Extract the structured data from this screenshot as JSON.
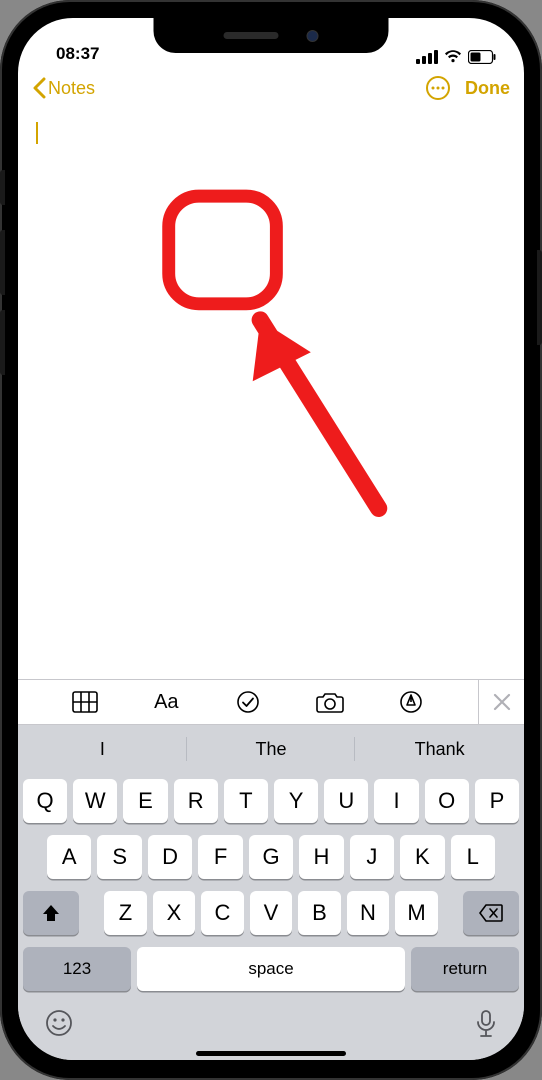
{
  "status": {
    "time": "08:37"
  },
  "nav": {
    "back_label": "Notes",
    "done_label": "Done"
  },
  "toolbar": {
    "icons": [
      "table-icon",
      "text-format-icon",
      "checklist-icon",
      "camera-icon",
      "markup-icon"
    ]
  },
  "suggestions": [
    "I",
    "The",
    "Thank"
  ],
  "keyboard": {
    "row1": [
      "Q",
      "W",
      "E",
      "R",
      "T",
      "Y",
      "U",
      "I",
      "O",
      "P"
    ],
    "row2": [
      "A",
      "S",
      "D",
      "F",
      "G",
      "H",
      "J",
      "K",
      "L"
    ],
    "row3": [
      "Z",
      "X",
      "C",
      "V",
      "B",
      "N",
      "M"
    ],
    "numbers_label": "123",
    "space_label": "space",
    "return_label": "return"
  },
  "colors": {
    "accent": "#d3a400",
    "annotation": "#ee1c1c"
  }
}
